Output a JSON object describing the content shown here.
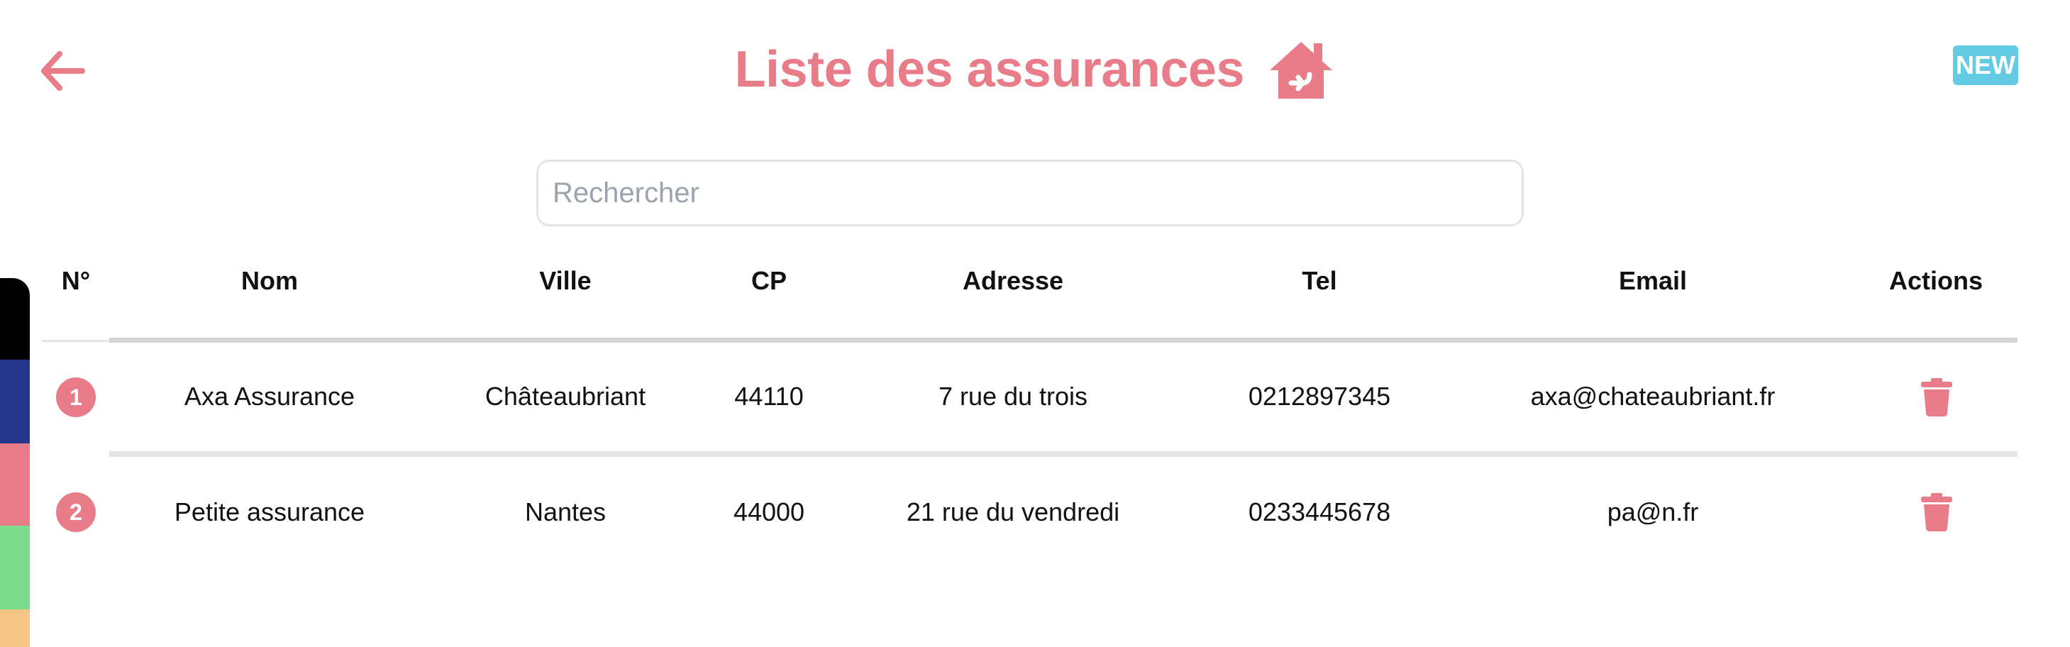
{
  "header": {
    "title": "Liste des assurances",
    "back_icon": "arrow-left-icon",
    "home_icon": "house-arrow-icon",
    "new_label": "NEW"
  },
  "search": {
    "placeholder": "Rechercher",
    "value": ""
  },
  "table": {
    "columns": [
      "N°",
      "Nom",
      "Ville",
      "CP",
      "Adresse",
      "Tel",
      "Email",
      "Actions"
    ],
    "rows": [
      {
        "num": "1",
        "nom": "Axa Assurance",
        "ville": "Châteaubriant",
        "cp": "44110",
        "adresse": "7 rue du trois",
        "tel": "0212897345",
        "email": "axa@chateaubriant.fr",
        "action_icon": "trash-icon"
      },
      {
        "num": "2",
        "nom": "Petite assurance",
        "ville": "Nantes",
        "cp": "44000",
        "adresse": "21 rue du vendredi",
        "tel": "0233445678",
        "email": "pa@n.fr",
        "action_icon": "trash-icon"
      }
    ]
  },
  "colors": {
    "accent": "#e87c88",
    "new_button": "#63cbe3",
    "separator": "#e4e4e7",
    "header_separator": "#d4d4d8",
    "side_strip": [
      "#000000",
      "#25378c",
      "#e87c88",
      "#7ddd8e",
      "#f5c487"
    ]
  }
}
